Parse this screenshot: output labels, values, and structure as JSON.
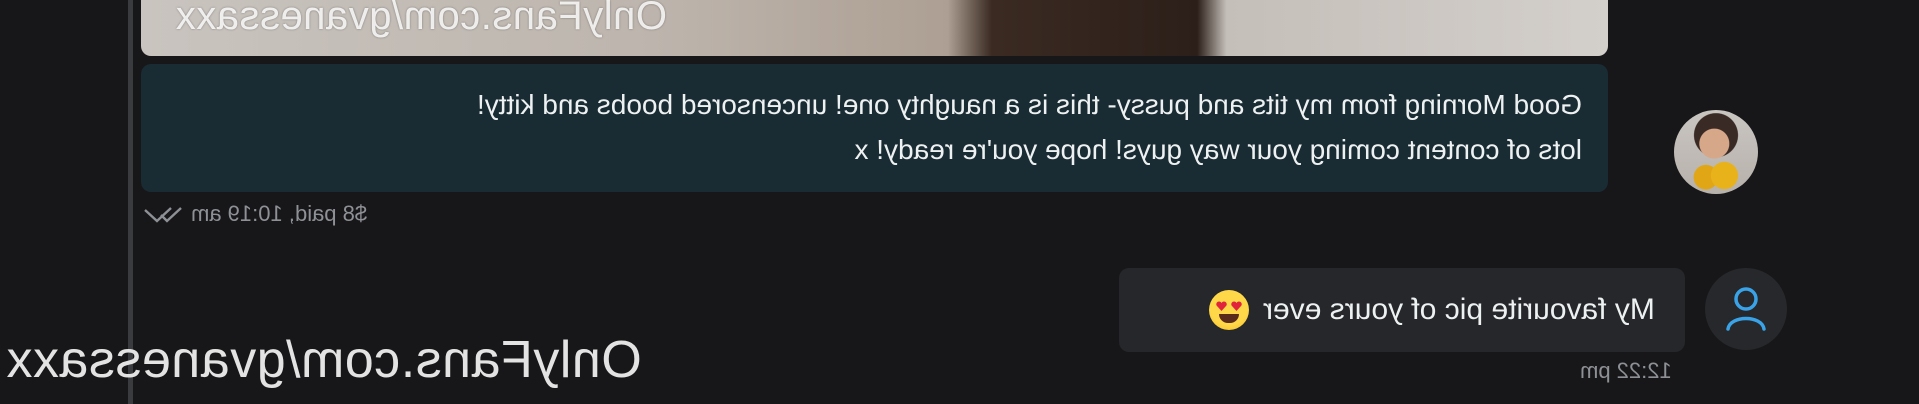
{
  "media": {
    "watermark": "OnlyFans.com/gvanessaxx"
  },
  "incoming_message": {
    "lines": [
      "Good Morning from my tits and pussy- this is a naughty one! uncensored boobs and kitty!",
      "lots of content coming your way guys! hope you're ready! x"
    ],
    "meta": "$8 paid, 10:19 am"
  },
  "outgoing_message": {
    "text": "My favourite pic of yours ever",
    "emoji": "heart-eyes-emoji",
    "time": "12:22 pm"
  },
  "page_watermark": "OnlyFans.com/gvanessaxx",
  "colors": {
    "background": "#171719",
    "incoming_bubble": "#1a2c33",
    "outgoing_bubble": "#25272a",
    "accent": "#3aa3e8"
  }
}
